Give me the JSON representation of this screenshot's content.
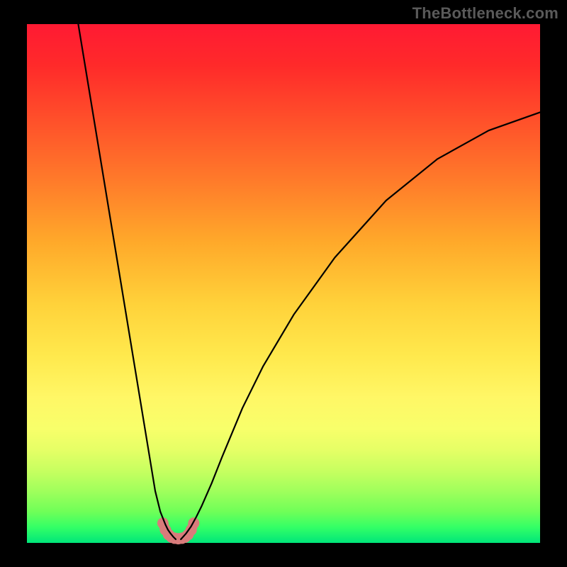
{
  "watermark": "TheBottleneck.com",
  "colors": {
    "frame": "#000000",
    "curve": "#000000",
    "floor": "#d97b7b"
  },
  "chart_data": {
    "type": "line",
    "title": "",
    "xlabel": "",
    "ylabel": "",
    "xlim": [
      0,
      100
    ],
    "ylim": [
      0,
      100
    ],
    "series": [
      {
        "name": "left-curve",
        "x": [
          10,
          12,
          14,
          16,
          18,
          20,
          22,
          24,
          25,
          26,
          27,
          27.5,
          28,
          28.5,
          29
        ],
        "y": [
          100,
          88,
          76,
          64,
          52,
          40,
          28,
          16,
          10,
          6,
          3.5,
          2.5,
          1.8,
          1.2,
          0.7
        ]
      },
      {
        "name": "right-curve",
        "x": [
          30,
          31,
          32,
          33,
          34,
          36,
          38,
          42,
          46,
          52,
          60,
          70,
          80,
          90,
          100
        ],
        "y": [
          0.7,
          1.8,
          3.2,
          5.0,
          7.0,
          11.5,
          16.5,
          26,
          34,
          44,
          55,
          66,
          74,
          79.5,
          83
        ]
      },
      {
        "name": "floor-arc",
        "x": [
          26.5,
          27.0,
          27.6,
          28.2,
          28.8,
          29.5,
          30.2,
          30.8,
          31.4,
          32.0,
          32.5
        ],
        "y": [
          3.8,
          2.5,
          1.6,
          1.1,
          0.9,
          0.8,
          0.9,
          1.1,
          1.6,
          2.5,
          3.8
        ]
      }
    ],
    "floor_dots": {
      "x": [
        26.5,
        27.0,
        27.6,
        28.2,
        28.8,
        29.5,
        30.2,
        30.8,
        31.4,
        32.0,
        32.5
      ],
      "y": [
        3.8,
        2.5,
        1.6,
        1.1,
        0.9,
        0.8,
        0.9,
        1.1,
        1.6,
        2.5,
        3.8
      ]
    }
  }
}
